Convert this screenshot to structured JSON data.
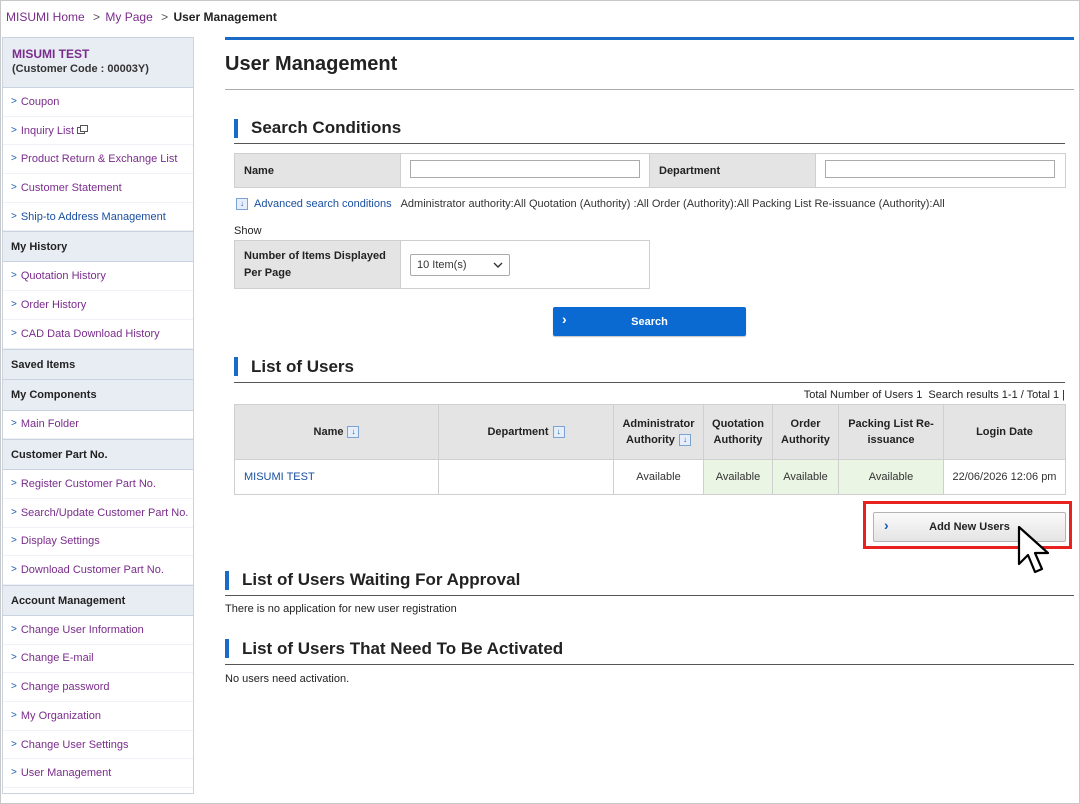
{
  "breadcrumb": {
    "home": "MISUMI Home",
    "sep1": ">",
    "mypage": "My Page",
    "sep2": ">",
    "current": "User Management"
  },
  "sidebar": {
    "account_name": "MISUMI TEST",
    "customer_code": "(Customer Code : 00003Y)",
    "top_links": [
      "Coupon",
      "Inquiry List",
      "Product Return & Exchange List",
      "Customer Statement",
      "Ship-to Address Management"
    ],
    "sections": [
      {
        "title": "My History",
        "links": [
          "Quotation History",
          "Order History",
          "CAD Data Download History"
        ]
      },
      {
        "title": "Saved Items",
        "links": []
      },
      {
        "title": "My Components",
        "links": [
          "Main Folder"
        ]
      },
      {
        "title": "Customer Part No.",
        "links": [
          "Register Customer Part No.",
          "Search/Update Customer Part No.",
          "Display Settings",
          "Download Customer Part No."
        ]
      },
      {
        "title": "Account Management",
        "links": [
          "Change User Information",
          "Change E-mail",
          "Change password",
          "My Organization",
          "Change User Settings",
          "User Management"
        ]
      }
    ]
  },
  "page_title": "User Management",
  "search": {
    "heading": "Search Conditions",
    "name_label": "Name",
    "name_value": "",
    "department_label": "Department",
    "department_value": "",
    "advanced_link": "Advanced search conditions",
    "advanced_summary": "Administrator authority:All Quotation (Authority) :All Order (Authority):All Packing List Re-issuance (Authority):All",
    "show_label": "Show",
    "items_label_line1": "Number of Items Displayed",
    "items_label_line2": "Per Page",
    "items_value": "10 Item(s)",
    "search_button": "Search"
  },
  "users": {
    "heading": "List of Users",
    "summary": "Total Number of Users 1  Search results 1-1 / Total 1 |",
    "columns": {
      "name": "Name",
      "department": "Department",
      "admin_l1": "Administrator",
      "admin_l2": "Authority",
      "quote_l1": "Quotation",
      "quote_l2": "Authority",
      "order_l1": "Order",
      "order_l2": "Authority",
      "packing_l1": "Packing List Re-",
      "packing_l2": "issuance",
      "login": "Login Date"
    },
    "rows": [
      {
        "name": "MISUMI TEST",
        "department": "",
        "admin": "Available",
        "quotation": "Available",
        "order": "Available",
        "packing": "Available",
        "login": "22/06/2026 12:06 pm"
      }
    ],
    "add_button": "Add New Users"
  },
  "approval": {
    "heading": "List of Users Waiting For Approval",
    "message": "There is no application for new user registration"
  },
  "activation": {
    "heading": "List of Users That Need To Be Activated",
    "message": "No users need activation."
  },
  "colors": {
    "accent_blue": "#1a6bc8",
    "link_purple": "#7a2c8c",
    "highlight_red": "#e8231f",
    "available_green": "#eaf5e4"
  }
}
